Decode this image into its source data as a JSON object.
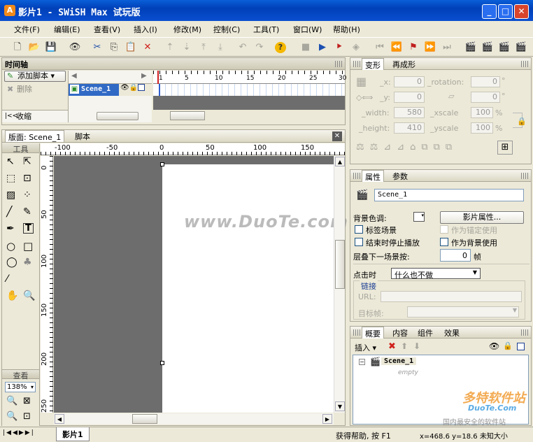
{
  "window": {
    "title": "影片1 - SWiSH Max 试玩版",
    "app_icon": "A",
    "min": "_",
    "max": "□",
    "close": "✕"
  },
  "menu": [
    "文件(F)",
    "编辑(E)",
    "查看(V)",
    "插入(I)",
    "修改(M)",
    "控制(C)",
    "工具(T)",
    "窗口(W)",
    "帮助(H)"
  ],
  "timeline": {
    "title": "时间轴",
    "add_script": "添加脚本 ▾",
    "delete": "删除",
    "collapse": "收缩",
    "scene": "Scene_1",
    "frames": [
      "1",
      "5",
      "10",
      "15",
      "20",
      "25",
      "30"
    ]
  },
  "stage": {
    "tabs": [
      "版面: Scene_1",
      "脚本"
    ],
    "h_ruler": [
      "-100",
      "-50",
      "0",
      "50",
      "100",
      "150"
    ],
    "v_ruler": [
      "0",
      "50",
      "100",
      "150",
      "200",
      "250"
    ],
    "watermark": "www.DuoTe.com"
  },
  "tools": {
    "title": "工具",
    "view_title": "查看",
    "zoom": "138%"
  },
  "transform": {
    "tabs": [
      "变形",
      "再成形"
    ],
    "x_label": "_x:",
    "x": "0",
    "rotation_label": "_rotation:",
    "rotation": "0",
    "y_label": "_y:",
    "y": "0",
    "skew": "0",
    "width_label": "_width:",
    "width": "580",
    "xscale_label": "_xscale",
    "xscale": "100",
    "height_label": "_height:",
    "height": "410",
    "yscale_label": "_yscale",
    "yscale": "100",
    "pct": "%",
    "deg": "°"
  },
  "props": {
    "tabs": [
      "属性",
      "参数"
    ],
    "name": "Scene_1",
    "bg_label": "背景色调:",
    "movie_props": "影片属性...",
    "cb_label": "标签场景",
    "cb_anchor": "作为锚定使用",
    "cb_stop": "结束时停止播放",
    "cb_bg": "作为背景使用",
    "next_label": "层叠下一场景按:",
    "next_val": "0",
    "next_unit": "帧",
    "click_label": "点击时",
    "click_val": "什么也不做",
    "link_label": "链接",
    "url_label": "URL:",
    "target_label": "目标帧:"
  },
  "outline": {
    "tabs": [
      "概要",
      "内容",
      "组件",
      "效果"
    ],
    "insert": "插入 ▾",
    "scene": "Scene_1",
    "empty": "empty"
  },
  "status": {
    "tab": "影片1",
    "help": "获得帮助, 按 F1",
    "coords": "x=468.6 y=18.6 未知大小"
  },
  "logo": {
    "text": "多特软件站",
    "sub": "DuoTe.Com",
    "tag": "国内最安全的软件站"
  }
}
